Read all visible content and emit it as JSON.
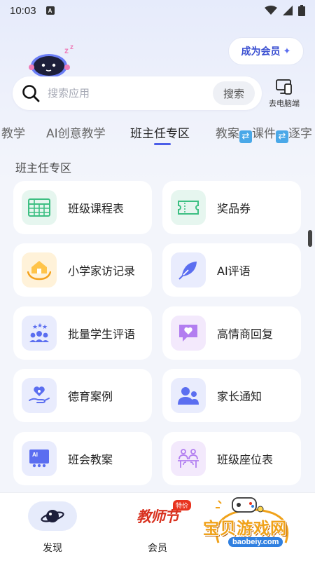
{
  "status_bar": {
    "time": "10:03",
    "notif_letter": "A"
  },
  "header": {
    "member_button": "成为会员",
    "member_star": "✦"
  },
  "search": {
    "placeholder": "搜索应用",
    "button": "搜索",
    "pc_link": "去电脑端"
  },
  "tabs": {
    "items": [
      "教学",
      "AI创意教学",
      "班主任专区",
      "教案",
      "课件",
      "逐字"
    ],
    "active": "班主任专区"
  },
  "section": {
    "title": "班主任专区"
  },
  "cards": [
    {
      "label": "班级课程表",
      "icon": "timetable-icon",
      "color": "#e6f6ef"
    },
    {
      "label": "奖品券",
      "icon": "ticket-icon",
      "color": "#e6f6ef"
    },
    {
      "label": "小学家访记录",
      "icon": "home-visit-icon",
      "color": "#fff2d9"
    },
    {
      "label": "AI评语",
      "icon": "feather-pen-icon",
      "color": "#e9ecfd"
    },
    {
      "label": "批量学生评语",
      "icon": "students-stars-icon",
      "color": "#e9ecfd"
    },
    {
      "label": "高情商回复",
      "icon": "heart-chat-icon",
      "color": "#f3e9fc"
    },
    {
      "label": "德育案例",
      "icon": "heart-hand-icon",
      "color": "#e9ecfd"
    },
    {
      "label": "家长通知",
      "icon": "parents-icon",
      "color": "#e9ecfd"
    },
    {
      "label": "班会教案",
      "icon": "meeting-board-icon",
      "color": "#e9ecfd"
    },
    {
      "label": "班级座位表",
      "icon": "seating-icon",
      "color": "#f3e9fc"
    }
  ],
  "bottom_nav": {
    "discover": "发现",
    "member": "会员",
    "teacher_logo": "教师节",
    "special_tag": "特价"
  },
  "watermark": {
    "title": "宝贝游戏网",
    "url": "baobeiy.com"
  },
  "colors": {
    "accent": "#4b5ee8",
    "background": "#f3f5fb",
    "logo_red": "#d8311f"
  }
}
